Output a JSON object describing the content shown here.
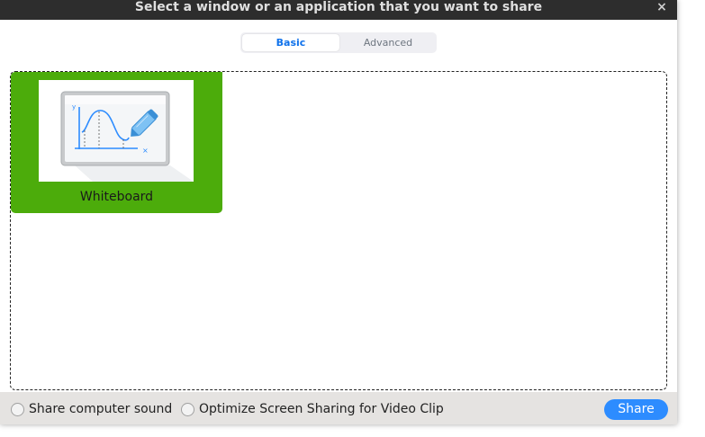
{
  "dialog": {
    "title": "Select a window or an application that you want to share",
    "close_icon": "×"
  },
  "tabs": {
    "basic": "Basic",
    "advanced": "Advanced",
    "selected": "Basic"
  },
  "sources": [
    {
      "label": "Whiteboard",
      "icon": "whiteboard-icon",
      "selected": true
    }
  ],
  "footer": {
    "share_sound_label": "Share computer sound",
    "share_sound_checked": false,
    "optimize_label": "Optimize Screen Sharing for Video Clip",
    "optimize_checked": false,
    "share_button": "Share"
  },
  "colors": {
    "accent": "#0e71eb",
    "selection": "#4cac0b",
    "share_button": "#2d8cff",
    "titlebar": "#2d2d2d"
  }
}
